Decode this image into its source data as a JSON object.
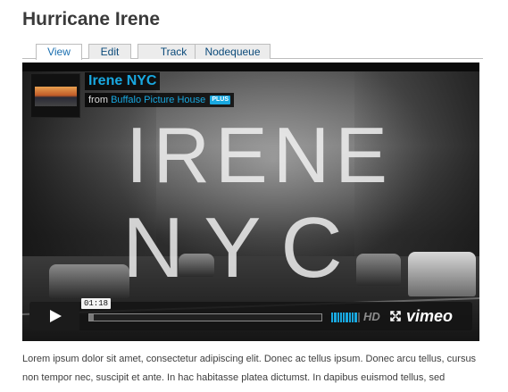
{
  "page": {
    "title": "Hurricane Irene"
  },
  "tabs": [
    {
      "label": "View",
      "active": true
    },
    {
      "label": "Edit",
      "active": false
    },
    {
      "label": "Track",
      "active": false
    },
    {
      "label": "Nodequeue",
      "active": false
    }
  ],
  "video": {
    "title": "Irene NYC",
    "byline_prefix": "from",
    "author": "Buffalo Picture House",
    "author_badge": "PLUS",
    "overlay_line1": "IRENE",
    "overlay_line2": "NYC",
    "player": {
      "current_time": "01:18",
      "progress": 0.02,
      "volume_level": 0.9,
      "hd_label": "HD",
      "brand": "vimeo",
      "accent_color": "#19a8e0"
    }
  },
  "body": {
    "paragraph": "Lorem ipsum dolor sit amet, consectetur adipiscing elit. Donec ac tellus ipsum. Donec arcu tellus, cursus non tempor nec, suscipit et ante. In hac habitasse platea dictumst. In dapibus euismod tellus, sed tristique arcu facilisis ac. Praesent vitae nunc at elit blandit feugiat. Nulla"
  },
  "icons": {
    "play": "play-icon",
    "fullscreen": "fullscreen-icon"
  }
}
